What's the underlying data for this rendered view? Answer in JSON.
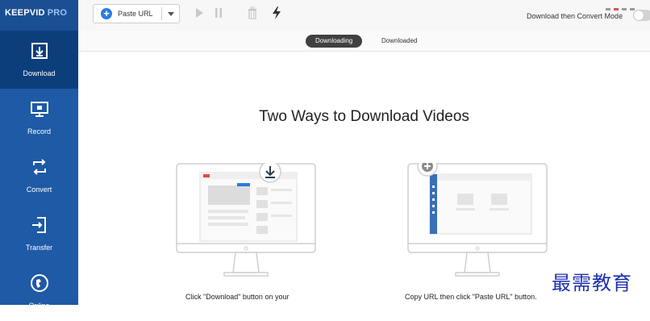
{
  "app": {
    "logo_main": "KEEPVID",
    "logo_pro": "PRO"
  },
  "sidebar": {
    "items": [
      {
        "label": "Download",
        "icon": "download-icon",
        "active": true
      },
      {
        "label": "Record",
        "icon": "record-icon",
        "active": false
      },
      {
        "label": "Convert",
        "icon": "convert-icon",
        "active": false
      },
      {
        "label": "Transfer",
        "icon": "transfer-icon",
        "active": false
      },
      {
        "label": "Online",
        "icon": "online-icon",
        "active": false
      }
    ]
  },
  "toolbar": {
    "paste_url_label": "Paste URL",
    "mode_label": "Download then Convert Mode",
    "mode_enabled": false
  },
  "tabs": [
    {
      "label": "Downloading",
      "active": true
    },
    {
      "label": "Downloaded",
      "active": false
    }
  ],
  "main": {
    "heading": "Two Ways to Download Videos",
    "way1_caption": "Click \"Download\" button on your",
    "way2_caption": "Copy URL then click \"Paste URL\" button."
  },
  "watermark": "最需教育",
  "colors": {
    "sidebar": "#1e5aa5",
    "sidebar_active": "#0d3e7c",
    "accent": "#2a7be0",
    "watermark": "#1e2fb0"
  }
}
